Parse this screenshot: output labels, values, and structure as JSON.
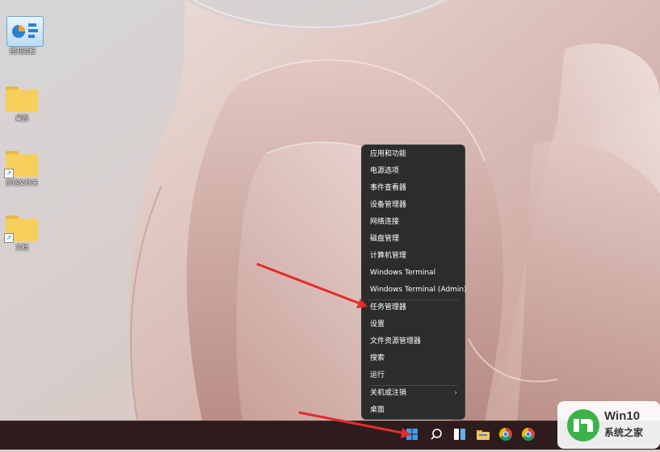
{
  "desktop": {
    "icons": [
      {
        "label": "控制面板",
        "icon": "control-panel-icon"
      },
      {
        "label": "桌面",
        "icon": "folder-icon"
      },
      {
        "label": "示例文件夹",
        "icon": "folder-shortcut-icon"
      },
      {
        "label": "文档",
        "icon": "folder-shortcut-icon"
      }
    ]
  },
  "context_menu": {
    "items": [
      {
        "label": "应用和功能"
      },
      {
        "label": "电源选项"
      },
      {
        "label": "事件查看器"
      },
      {
        "label": "设备管理器"
      },
      {
        "label": "网络连接"
      },
      {
        "label": "磁盘管理"
      },
      {
        "label": "计算机管理"
      },
      {
        "label": "Windows Terminal"
      },
      {
        "label": "Windows Terminal (Admin)"
      },
      {
        "label": "任务管理器"
      },
      {
        "label": "设置"
      },
      {
        "label": "文件资源管理器"
      },
      {
        "label": "搜索"
      },
      {
        "label": "运行"
      },
      {
        "label": "关机或注销"
      },
      {
        "label": "桌面"
      }
    ],
    "submenu_indicator": "›"
  },
  "taskbar": {
    "icons": [
      "start-icon",
      "search-icon",
      "widgets-icon",
      "file-explorer-icon",
      "chrome-icon",
      "chrome-icon"
    ]
  },
  "watermark": {
    "text1": "Win10",
    "text2": "系统之家"
  },
  "colors": {
    "menu_bg": "#2c2c2c",
    "taskbar_bg": "#2e1b1c",
    "annotation_arrow": "#e52b2b",
    "folder": "#f7cf5c"
  }
}
